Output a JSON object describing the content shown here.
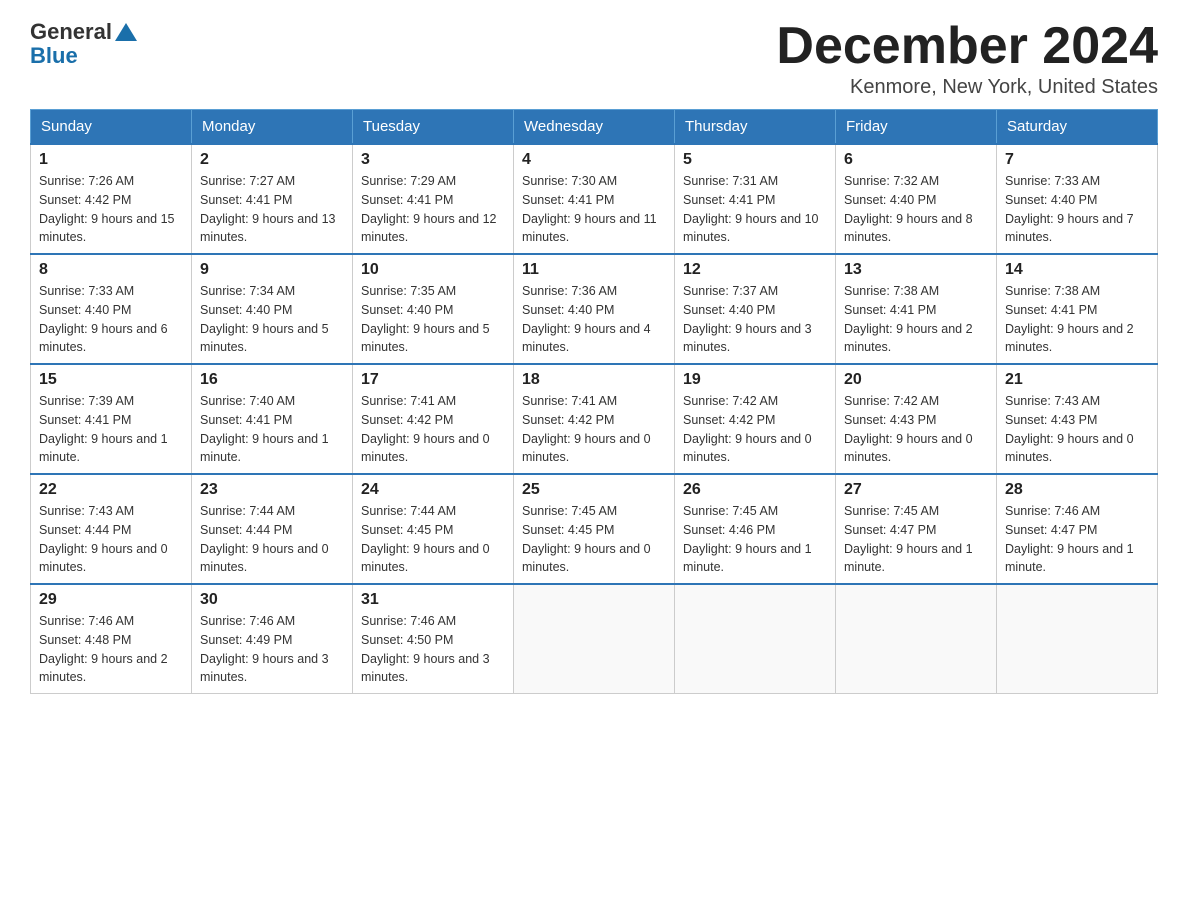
{
  "logo": {
    "general": "General",
    "blue": "Blue"
  },
  "title": "December 2024",
  "location": "Kenmore, New York, United States",
  "days_of_week": [
    "Sunday",
    "Monday",
    "Tuesday",
    "Wednesday",
    "Thursday",
    "Friday",
    "Saturday"
  ],
  "weeks": [
    [
      {
        "date": "1",
        "sunrise": "7:26 AM",
        "sunset": "4:42 PM",
        "daylight": "9 hours and 15 minutes."
      },
      {
        "date": "2",
        "sunrise": "7:27 AM",
        "sunset": "4:41 PM",
        "daylight": "9 hours and 13 minutes."
      },
      {
        "date": "3",
        "sunrise": "7:29 AM",
        "sunset": "4:41 PM",
        "daylight": "9 hours and 12 minutes."
      },
      {
        "date": "4",
        "sunrise": "7:30 AM",
        "sunset": "4:41 PM",
        "daylight": "9 hours and 11 minutes."
      },
      {
        "date": "5",
        "sunrise": "7:31 AM",
        "sunset": "4:41 PM",
        "daylight": "9 hours and 10 minutes."
      },
      {
        "date": "6",
        "sunrise": "7:32 AM",
        "sunset": "4:40 PM",
        "daylight": "9 hours and 8 minutes."
      },
      {
        "date": "7",
        "sunrise": "7:33 AM",
        "sunset": "4:40 PM",
        "daylight": "9 hours and 7 minutes."
      }
    ],
    [
      {
        "date": "8",
        "sunrise": "7:33 AM",
        "sunset": "4:40 PM",
        "daylight": "9 hours and 6 minutes."
      },
      {
        "date": "9",
        "sunrise": "7:34 AM",
        "sunset": "4:40 PM",
        "daylight": "9 hours and 5 minutes."
      },
      {
        "date": "10",
        "sunrise": "7:35 AM",
        "sunset": "4:40 PM",
        "daylight": "9 hours and 5 minutes."
      },
      {
        "date": "11",
        "sunrise": "7:36 AM",
        "sunset": "4:40 PM",
        "daylight": "9 hours and 4 minutes."
      },
      {
        "date": "12",
        "sunrise": "7:37 AM",
        "sunset": "4:40 PM",
        "daylight": "9 hours and 3 minutes."
      },
      {
        "date": "13",
        "sunrise": "7:38 AM",
        "sunset": "4:41 PM",
        "daylight": "9 hours and 2 minutes."
      },
      {
        "date": "14",
        "sunrise": "7:38 AM",
        "sunset": "4:41 PM",
        "daylight": "9 hours and 2 minutes."
      }
    ],
    [
      {
        "date": "15",
        "sunrise": "7:39 AM",
        "sunset": "4:41 PM",
        "daylight": "9 hours and 1 minute."
      },
      {
        "date": "16",
        "sunrise": "7:40 AM",
        "sunset": "4:41 PM",
        "daylight": "9 hours and 1 minute."
      },
      {
        "date": "17",
        "sunrise": "7:41 AM",
        "sunset": "4:42 PM",
        "daylight": "9 hours and 0 minutes."
      },
      {
        "date": "18",
        "sunrise": "7:41 AM",
        "sunset": "4:42 PM",
        "daylight": "9 hours and 0 minutes."
      },
      {
        "date": "19",
        "sunrise": "7:42 AM",
        "sunset": "4:42 PM",
        "daylight": "9 hours and 0 minutes."
      },
      {
        "date": "20",
        "sunrise": "7:42 AM",
        "sunset": "4:43 PM",
        "daylight": "9 hours and 0 minutes."
      },
      {
        "date": "21",
        "sunrise": "7:43 AM",
        "sunset": "4:43 PM",
        "daylight": "9 hours and 0 minutes."
      }
    ],
    [
      {
        "date": "22",
        "sunrise": "7:43 AM",
        "sunset": "4:44 PM",
        "daylight": "9 hours and 0 minutes."
      },
      {
        "date": "23",
        "sunrise": "7:44 AM",
        "sunset": "4:44 PM",
        "daylight": "9 hours and 0 minutes."
      },
      {
        "date": "24",
        "sunrise": "7:44 AM",
        "sunset": "4:45 PM",
        "daylight": "9 hours and 0 minutes."
      },
      {
        "date": "25",
        "sunrise": "7:45 AM",
        "sunset": "4:45 PM",
        "daylight": "9 hours and 0 minutes."
      },
      {
        "date": "26",
        "sunrise": "7:45 AM",
        "sunset": "4:46 PM",
        "daylight": "9 hours and 1 minute."
      },
      {
        "date": "27",
        "sunrise": "7:45 AM",
        "sunset": "4:47 PM",
        "daylight": "9 hours and 1 minute."
      },
      {
        "date": "28",
        "sunrise": "7:46 AM",
        "sunset": "4:47 PM",
        "daylight": "9 hours and 1 minute."
      }
    ],
    [
      {
        "date": "29",
        "sunrise": "7:46 AM",
        "sunset": "4:48 PM",
        "daylight": "9 hours and 2 minutes."
      },
      {
        "date": "30",
        "sunrise": "7:46 AM",
        "sunset": "4:49 PM",
        "daylight": "9 hours and 3 minutes."
      },
      {
        "date": "31",
        "sunrise": "7:46 AM",
        "sunset": "4:50 PM",
        "daylight": "9 hours and 3 minutes."
      },
      null,
      null,
      null,
      null
    ]
  ],
  "labels": {
    "sunrise": "Sunrise:",
    "sunset": "Sunset:",
    "daylight": "Daylight:"
  }
}
